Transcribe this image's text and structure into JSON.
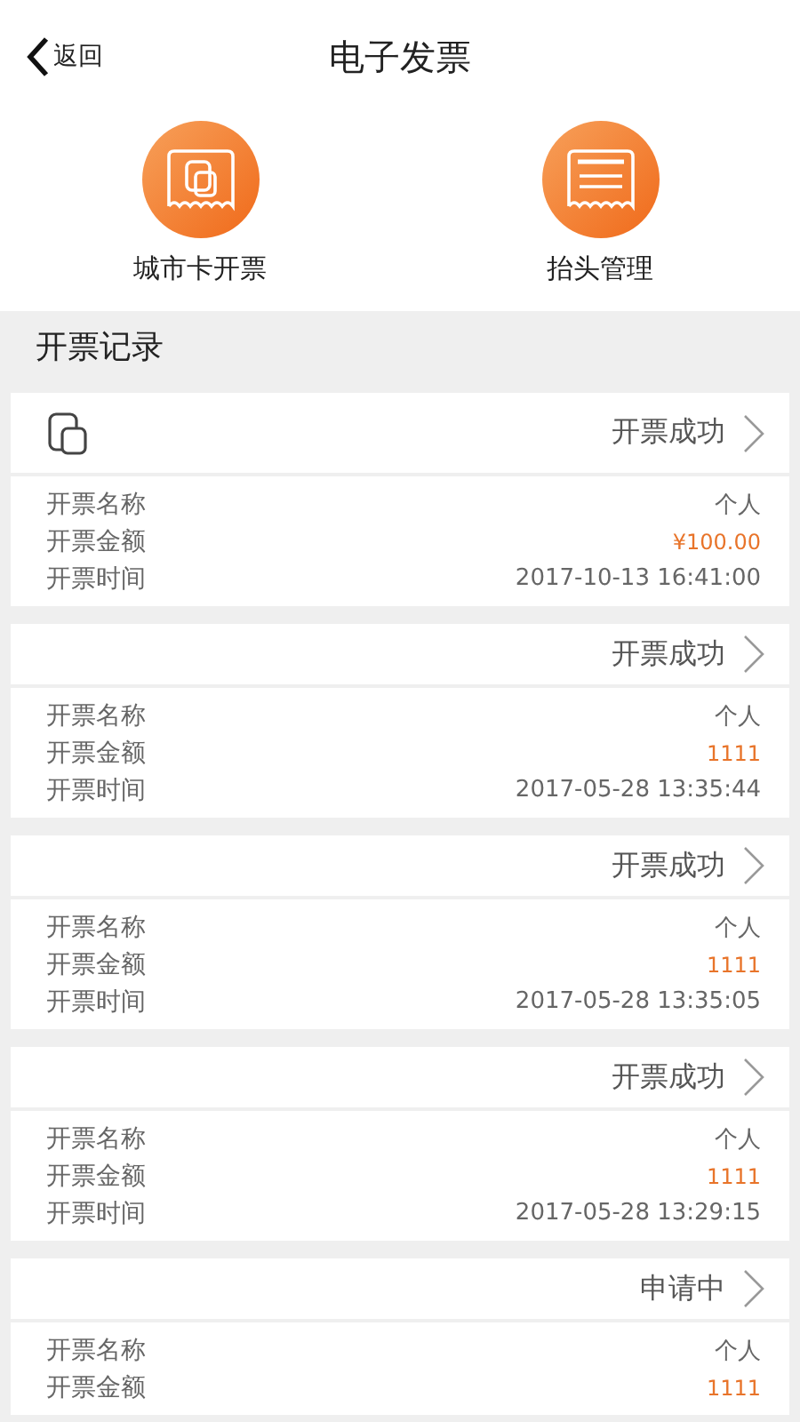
{
  "nav": {
    "back": "返回",
    "title": "电子发票"
  },
  "actions": [
    {
      "kind": "card",
      "label": "城市卡开票"
    },
    {
      "kind": "list",
      "label": "抬头管理"
    }
  ],
  "section_title": "开票记录",
  "records": [
    {
      "icon": true,
      "status": "开票成功",
      "rows": [
        {
          "label": "开票名称",
          "value": "个人",
          "kind": "plain"
        },
        {
          "label": "开票金额",
          "value": "¥100.00",
          "kind": "amount"
        },
        {
          "label": "开票时间",
          "value": "2017-10-13 16:41:00",
          "kind": "plain"
        }
      ]
    },
    {
      "icon": false,
      "status": "开票成功",
      "rows": [
        {
          "label": "开票名称",
          "value": "个人",
          "kind": "plain"
        },
        {
          "label": "开票金额",
          "value": "1111",
          "kind": "amount"
        },
        {
          "label": "开票时间",
          "value": "2017-05-28 13:35:44",
          "kind": "plain"
        }
      ]
    },
    {
      "icon": false,
      "status": "开票成功",
      "rows": [
        {
          "label": "开票名称",
          "value": "个人",
          "kind": "plain"
        },
        {
          "label": "开票金额",
          "value": "1111",
          "kind": "amount"
        },
        {
          "label": "开票时间",
          "value": "2017-05-28 13:35:05",
          "kind": "plain"
        }
      ]
    },
    {
      "icon": false,
      "status": "开票成功",
      "rows": [
        {
          "label": "开票名称",
          "value": "个人",
          "kind": "plain"
        },
        {
          "label": "开票金额",
          "value": "1111",
          "kind": "amount"
        },
        {
          "label": "开票时间",
          "value": "2017-05-28 13:29:15",
          "kind": "plain"
        }
      ]
    },
    {
      "icon": false,
      "status": "申请中",
      "rows": [
        {
          "label": "开票名称",
          "value": "个人",
          "kind": "plain"
        },
        {
          "label": "开票金额",
          "value": "1111",
          "kind": "amount"
        }
      ]
    }
  ]
}
